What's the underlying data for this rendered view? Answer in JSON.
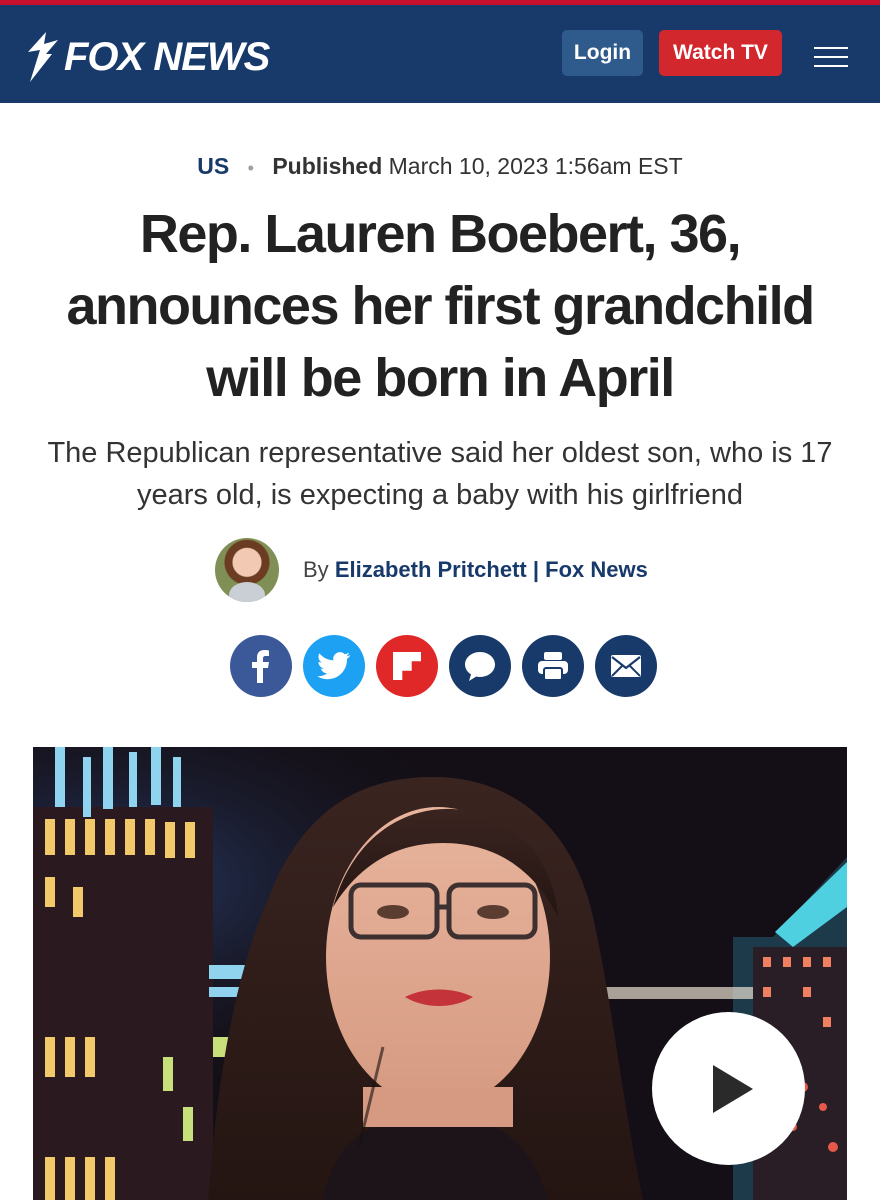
{
  "header": {
    "logo_text": "FOX NEWS",
    "login_label": "Login",
    "watch_label": "Watch TV",
    "menu_icon": "hamburger-menu-icon"
  },
  "article": {
    "category": "US",
    "published_label": "Published",
    "published_date": "March 10, 2023 1:56am EST",
    "headline": "Rep. Lauren Boebert, 36, announces her first grandchild will be born in April",
    "subhead": "The Republican representative said her oldest son, who is 17 years old, is expecting a baby with his girlfriend",
    "byline_prefix": "By",
    "author": "Elizabeth Pritchett",
    "byline_sep": "|",
    "outlet": "Fox News"
  },
  "share_icons": [
    "facebook-icon",
    "twitter-icon",
    "flipboard-icon",
    "comments-icon",
    "print-icon",
    "email-icon"
  ],
  "colors": {
    "header_bg": "#183a6b",
    "accent_red": "#d3272e",
    "link_blue": "#183a6b"
  },
  "video": {
    "play_icon": "play-icon"
  }
}
